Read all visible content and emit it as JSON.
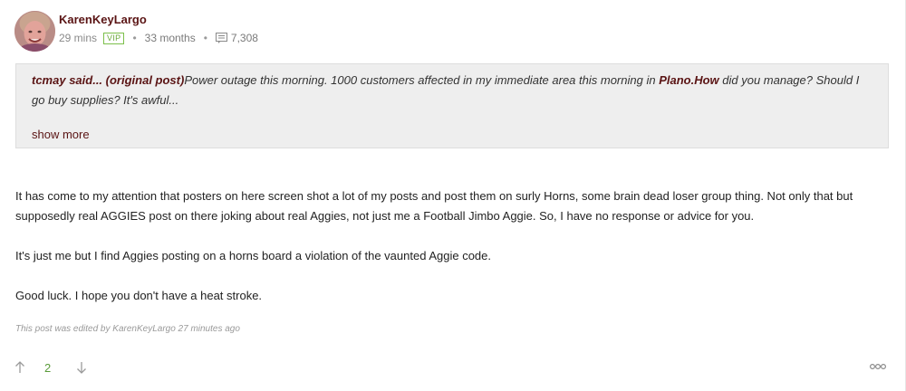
{
  "author": {
    "name": "KarenKeyLargo",
    "time_ago": "29 mins",
    "badge": "VIP",
    "member_for": "33 months",
    "post_count": "7,308"
  },
  "quote": {
    "attribution": "tcmay said... (original post)",
    "text_before": "Power outage this morning. 1000 customers affected in my immediate area this morning in ",
    "location": "Plano.How",
    "text_after": " did you manage? Should I go buy supplies? It's awful...",
    "show_more": "show more"
  },
  "body": {
    "paragraph_1": "It has come to my attention that posters on here screen shot a lot of my posts and post them on surly Horns, some brain dead loser group thing. Not only that but supposedly real AGGIES post on there joking about real Aggies, not just me a Football Jimbo Aggie. So, I have no response or advice for you.",
    "paragraph_2": "It's just me but I find Aggies posting on a horns board a violation of the vaunted Aggie code.",
    "paragraph_3": "Good luck. I hope you don't have a heat stroke."
  },
  "edit_note": "This post was edited by KarenKeyLargo 27 minutes ago",
  "votes": {
    "score": "2"
  },
  "colors": {
    "author": "#5a1414",
    "vip": "#6aa83a",
    "quote_bg": "#eeeeee",
    "score": "#5a9b3a"
  },
  "icons": {
    "upvote": "arrow-up-icon",
    "downvote": "arrow-down-icon",
    "posts": "comment-icon",
    "more": "more-options-icon"
  }
}
